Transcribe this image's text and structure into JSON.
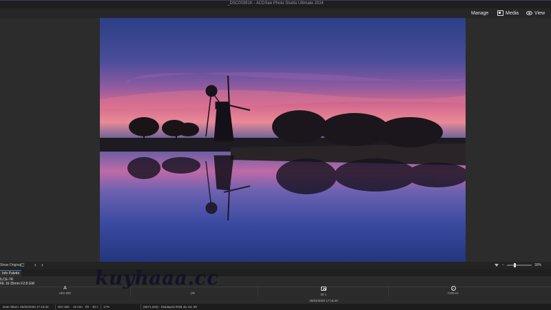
{
  "window": {
    "title": "_DSC00391K - ACDSee Photo Studio Ultimate 2024"
  },
  "modes": [
    {
      "label": "Manage",
      "icon": "grid-icon"
    },
    {
      "label": "Media",
      "icon": "media-icon"
    },
    {
      "label": "View",
      "icon": "eye-icon"
    }
  ],
  "viewer_toolbar": {
    "show_original": "Show Original",
    "prev_glyph": "‹",
    "next_glyph": "›",
    "zoom_minus": "−",
    "zoom_level": "30%",
    "zoom_fraction": 0.3
  },
  "info_palette": {
    "tab": "Info Palette",
    "camera_model": "ILCE-7R",
    "lens": "FE 16-35mm F2.8 GM",
    "exif": [
      {
        "glyph": "A",
        "value": "ISO 320"
      },
      {
        "glyph": "",
        "value": "ƒ/8"
      },
      {
        "glyph": "camera",
        "value": "30 s"
      },
      {
        "glyph": "ev",
        "value": "0.00 eV"
      }
    ],
    "date": "05/02/2020 17:16:20"
  },
  "status_bar": {
    "date_taken": "Date Taken: 05/02/2020 17:16:20",
    "iso": "ISO 320",
    "focal": "16 mm",
    "aperture": "f/8",
    "shutter": "30 s",
    "zoom": "17%",
    "color": "(8571,294) - Displayed RGB 45, 63, 99"
  },
  "watermark": "kuyhaaa.cc",
  "colors": {
    "accent": "#4a6fa5",
    "background": "#2c2c2c"
  }
}
